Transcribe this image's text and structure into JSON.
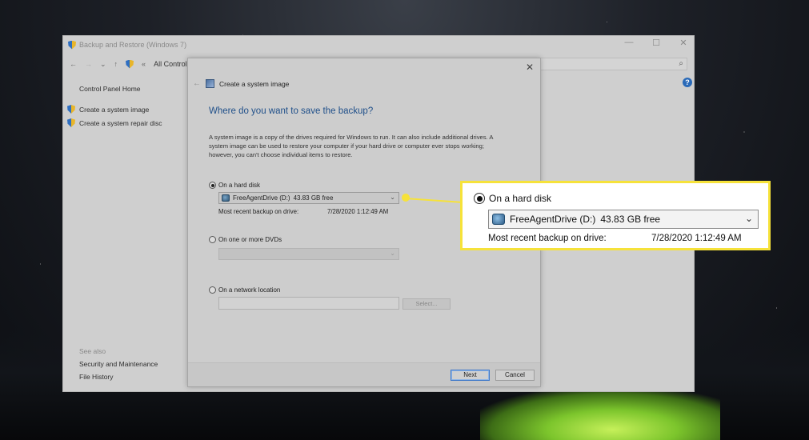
{
  "window": {
    "title": "Backup and Restore (Windows 7)",
    "address": "All Control Pa",
    "controls": {
      "minimize": "—",
      "maximize": "☐",
      "close": "✕"
    }
  },
  "sidebar": {
    "home": "Control Panel Home",
    "links": [
      {
        "label": "Create a system image"
      },
      {
        "label": "Create a system repair disc"
      }
    ],
    "see_also_title": "See also",
    "see_also": [
      {
        "label": "Security and Maintenance"
      },
      {
        "label": "File History"
      }
    ]
  },
  "dialog": {
    "title": "Create a system image",
    "heading": "Where do you want to save the backup?",
    "description": "A system image is a copy of the drives required for Windows to run. It can also include additional drives. A system image can be used to restore your computer if your hard drive or computer ever stops working; however, you can't choose individual items to restore.",
    "options": {
      "hard_disk": {
        "label": "On a hard disk",
        "selected": true,
        "drive": "FreeAgentDrive (D:)",
        "free": "43.83 GB free",
        "recent_label": "Most recent backup on drive:",
        "recent_value": "7/28/2020 1:12:49 AM"
      },
      "dvds": {
        "label": "On one or more DVDs",
        "selected": false
      },
      "network": {
        "label": "On a network location",
        "selected": false,
        "select_button": "Select..."
      }
    },
    "buttons": {
      "next": "Next",
      "cancel": "Cancel"
    }
  },
  "callout": {
    "label": "On a hard disk",
    "drive": "FreeAgentDrive (D:)",
    "free": "43.83 GB free",
    "recent_label": "Most recent backup on drive:",
    "recent_value": "7/28/2020 1:12:49 AM",
    "accent": "#f6e23a"
  }
}
